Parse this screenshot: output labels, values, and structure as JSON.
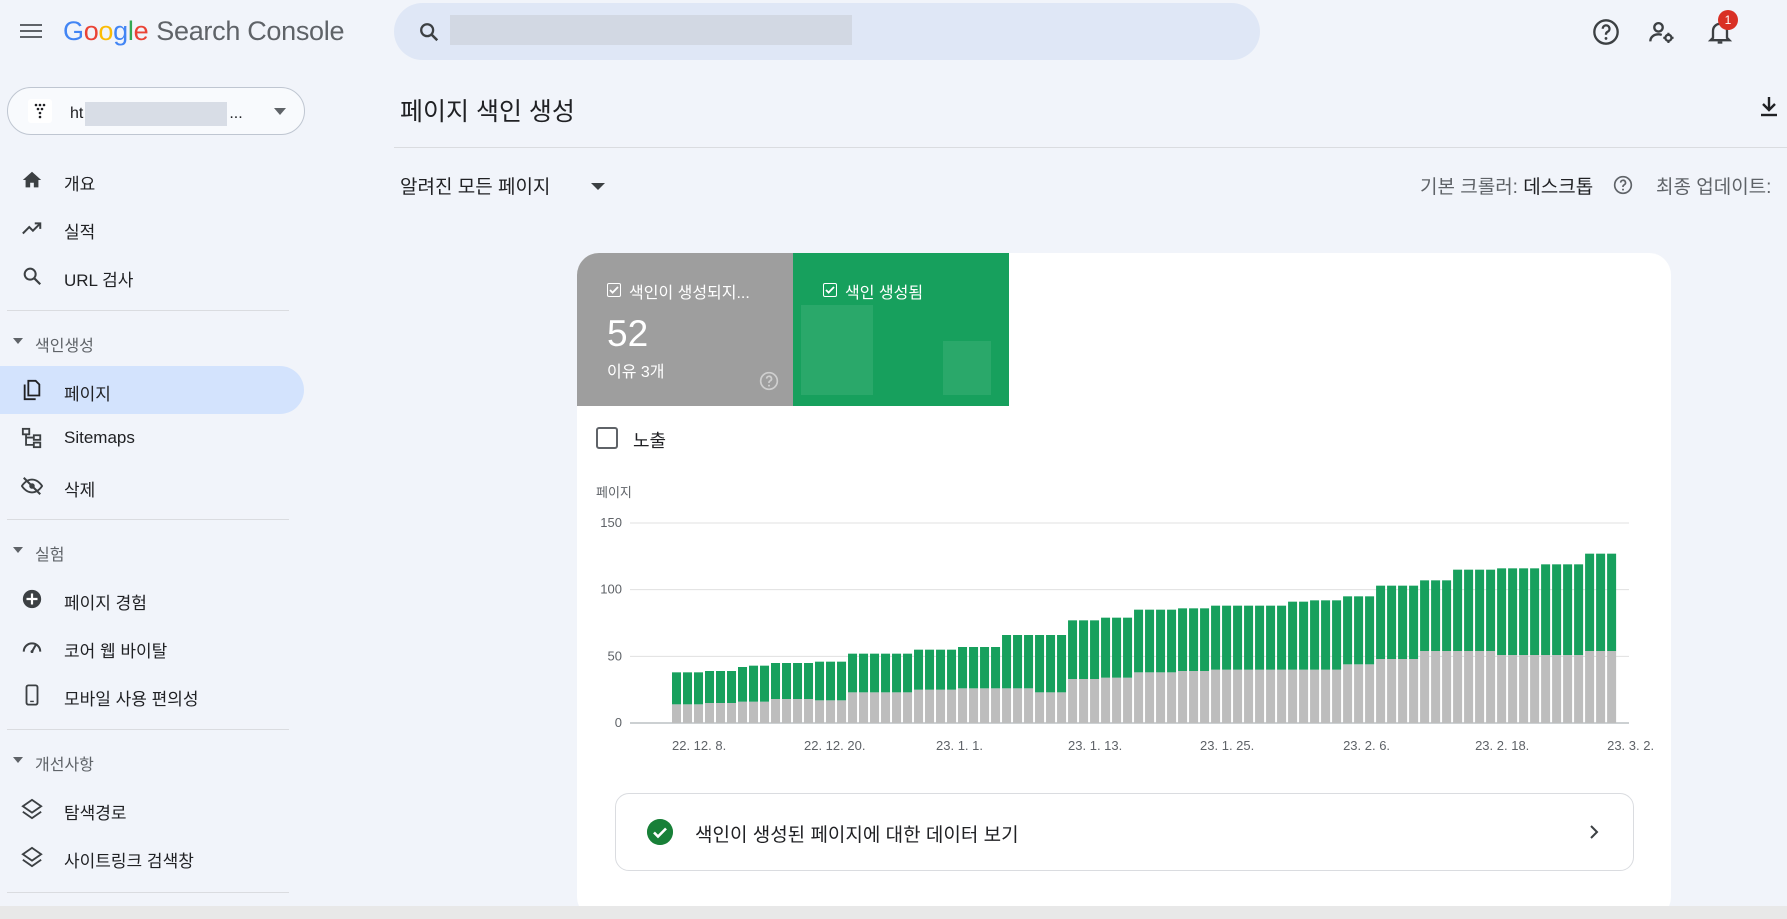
{
  "header": {
    "brand": [
      "G",
      "o",
      "o",
      "g",
      "l",
      "e"
    ],
    "product": "Search Console",
    "search_placeholder": "",
    "notifications_count": "1"
  },
  "property": {
    "label": "ht",
    "suffix": "..."
  },
  "sidebar": {
    "items_top": [
      {
        "label": "개요",
        "icon": "home-icon"
      },
      {
        "label": "실적",
        "icon": "trending-up-icon"
      },
      {
        "label": "URL 검사",
        "icon": "search-icon"
      }
    ],
    "section_indexing": "색인생성",
    "items_indexing": [
      {
        "label": "페이지",
        "icon": "pages-icon",
        "active": true
      },
      {
        "label": "Sitemaps",
        "icon": "sitemap-icon"
      },
      {
        "label": "삭제",
        "icon": "eye-off-icon"
      }
    ],
    "section_experience": "실험",
    "items_experience": [
      {
        "label": "페이지 경험",
        "icon": "plus-circle-icon"
      },
      {
        "label": "코어 웹 바이탈",
        "icon": "speedometer-icon"
      },
      {
        "label": "모바일 사용 편의성",
        "icon": "mobile-icon"
      }
    ],
    "section_enhancements": "개선사항",
    "items_enhancements": [
      {
        "label": "탐색경로",
        "icon": "layers-icon"
      },
      {
        "label": "사이트링크 검색창",
        "icon": "layers-icon"
      }
    ]
  },
  "main": {
    "title": "페이지 색인 생성",
    "filter": "알려진 모든 페이지",
    "crawler_label": "기본 크롤러:",
    "crawler_value": "데스크톱",
    "updated_label": "최종 업데이트:",
    "tile_not_indexed": {
      "label": "색인이 생성되지...",
      "value": "52",
      "sub": "이유 3개"
    },
    "tile_indexed": {
      "label": "색인 생성됨"
    },
    "impressions_label": "노출",
    "indexed_link": "색인이 생성된 페이지에 대한 데이터 보기"
  },
  "colors": {
    "not_indexed": "#bdbdbd",
    "indexed": "#17a05d",
    "accent": "#d3e3fd"
  },
  "chart_data": {
    "type": "bar",
    "ylabel": "페이지",
    "ylim": [
      0,
      150
    ],
    "yticks": [
      0,
      50,
      100,
      150
    ],
    "xtick_labels": [
      "22. 12. 8.",
      "22. 12. 20.",
      "23. 1. 1.",
      "23. 1. 13.",
      "23. 1. 25.",
      "23. 2. 6.",
      "23. 2. 18.",
      "23. 3. 2."
    ],
    "series": [
      {
        "name": "색인이 생성되지...",
        "values": [
          14,
          14,
          14,
          15,
          15,
          15,
          16,
          16,
          16,
          18,
          18,
          18,
          18,
          17,
          17,
          17,
          23,
          23,
          23,
          23,
          23,
          23,
          25,
          25,
          25,
          25,
          26,
          26,
          26,
          26,
          26,
          26,
          26,
          23,
          23,
          23,
          33,
          33,
          33,
          34,
          34,
          34,
          38,
          38,
          38,
          38,
          39,
          39,
          39,
          40,
          40,
          40,
          40,
          40,
          40,
          40,
          40,
          40,
          40,
          40,
          40,
          44,
          44,
          44,
          48,
          48,
          48,
          48,
          54,
          54,
          54,
          54,
          54,
          54,
          54,
          51,
          51,
          51,
          51,
          51,
          51,
          51,
          51,
          54,
          54,
          54
        ]
      },
      {
        "name": "색인 생성됨",
        "values": [
          24,
          24,
          24,
          24,
          24,
          24,
          26,
          27,
          27,
          27,
          27,
          27,
          27,
          29,
          29,
          29,
          29,
          29,
          29,
          29,
          29,
          29,
          30,
          30,
          30,
          30,
          31,
          31,
          31,
          31,
          40,
          40,
          40,
          43,
          43,
          43,
          44,
          44,
          44,
          45,
          45,
          45,
          47,
          47,
          47,
          47,
          47,
          47,
          47,
          48,
          48,
          48,
          48,
          48,
          48,
          48,
          51,
          51,
          52,
          52,
          52,
          51,
          51,
          51,
          55,
          55,
          55,
          55,
          53,
          53,
          53,
          61,
          61,
          61,
          61,
          65,
          65,
          65,
          65,
          68,
          68,
          68,
          68,
          73,
          73,
          73
        ]
      }
    ]
  }
}
